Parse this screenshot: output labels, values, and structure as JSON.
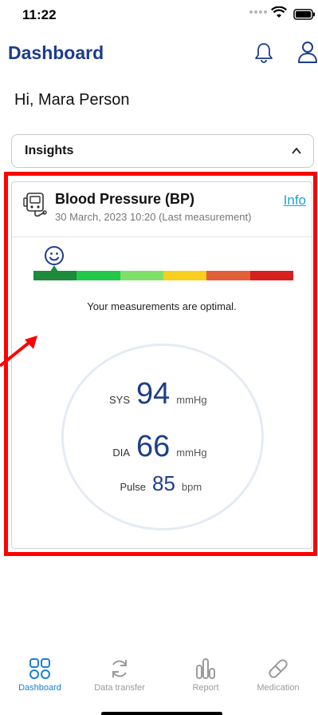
{
  "status_bar": {
    "time": "11:22"
  },
  "header": {
    "title": "Dashboard"
  },
  "greeting": "Hi, Mara Person",
  "insights": {
    "label": "Insights"
  },
  "bp_card": {
    "title": "Blood Pressure (BP)",
    "subtitle": "30 March, 2023 10:20 (Last measurement)",
    "info_label": "Info",
    "scale_colors": [
      "#1e8a3c",
      "#22c84a",
      "#7ee068",
      "#f7cf1c",
      "#e1603a",
      "#d81f1f"
    ],
    "message": "Your measurements are optimal.",
    "readings": {
      "sys_label": "SYS",
      "sys_value": "94",
      "sys_unit": "mmHg",
      "dia_label": "DIA",
      "dia_value": "66",
      "dia_unit": "mmHg",
      "pulse_label": "Pulse",
      "pulse_value": "85",
      "pulse_unit": "bpm"
    }
  },
  "tabs": [
    {
      "label": "Dashboard",
      "icon": "dashboard-icon",
      "active": true
    },
    {
      "label": "Data transfer",
      "icon": "sync-icon",
      "active": false
    },
    {
      "label": "Report",
      "icon": "report-icon",
      "active": false
    },
    {
      "label": "Medication",
      "icon": "pill-icon",
      "active": false
    }
  ],
  "colors": {
    "brand": "#1c3d8a",
    "accent": "#1aa3d6",
    "tab_active": "#1a7fd6",
    "tab_inactive": "#9a9a9a",
    "highlight": "#ff0000"
  }
}
